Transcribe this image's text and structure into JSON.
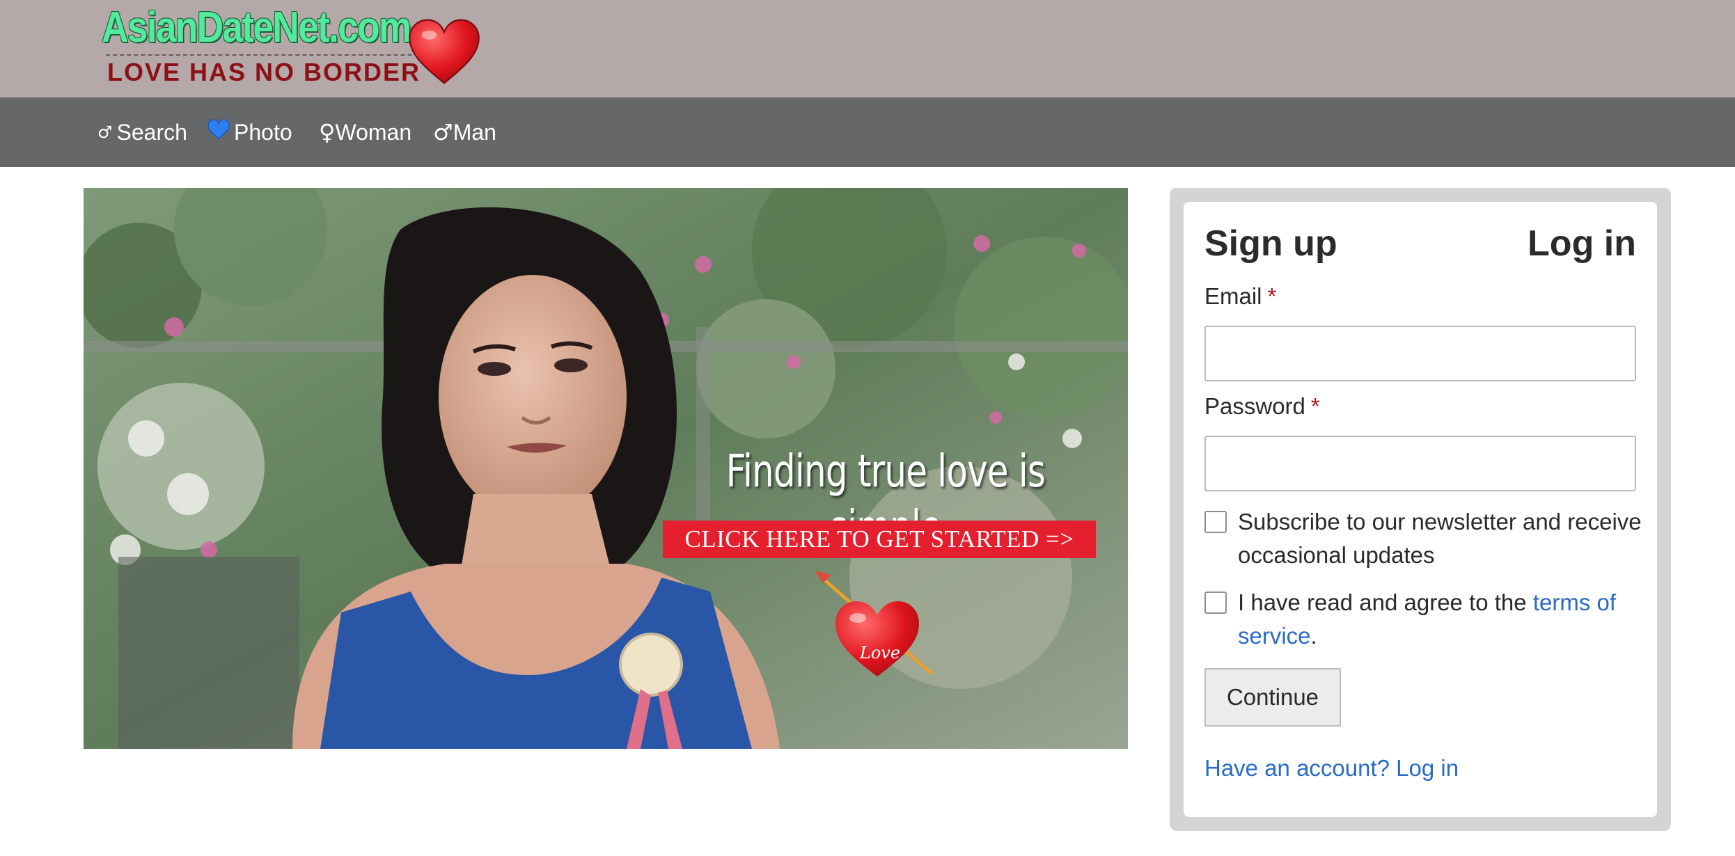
{
  "header": {
    "logo_text": "AsianDateNet.com",
    "logo_tagline": "LOVE HAS NO BORDER"
  },
  "nav": {
    "items": [
      {
        "glyph": "♂",
        "label": "Search",
        "icon": "male-symbol-icon"
      },
      {
        "glyph": "💙",
        "label": "Photo",
        "icon": "blue-heart-icon"
      },
      {
        "glyph": "♀",
        "label": "Woman",
        "icon": "female-symbol-icon"
      },
      {
        "glyph": "♂",
        "label": "Man",
        "icon": "male-symbol-icon"
      }
    ]
  },
  "hero": {
    "headline": "Finding true love is simple",
    "cta": "CLICK HERE TO GET STARTED =>",
    "heart_label": "Love"
  },
  "auth": {
    "signup_tab": "Sign up",
    "login_tab": "Log in",
    "email_label": "Email",
    "password_label": "Password",
    "required_marker": "*",
    "newsletter_text": "Subscribe to our newsletter and receive occasional updates",
    "terms_prefix": "I have read and agree to the ",
    "terms_link": "terms of service",
    "terms_suffix": ".",
    "continue_label": "Continue",
    "have_account_link": "Have an account? Log in"
  },
  "colors": {
    "header_bg": "#b5a8a8",
    "nav_bg": "#666769",
    "cta_red": "#e4202e",
    "link_blue": "#2a6bc4",
    "required_red": "#b3121a"
  }
}
